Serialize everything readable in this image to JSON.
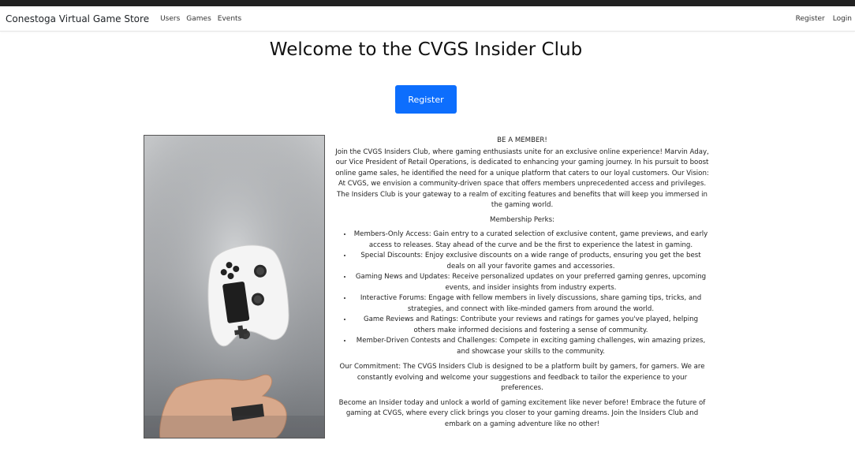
{
  "nav": {
    "brand": "Conestoga Virtual Game Store",
    "links": [
      "Users",
      "Games",
      "Events"
    ],
    "right_links": [
      "Register",
      "Login"
    ]
  },
  "main": {
    "title": "Welcome to the CVGS Insider Club",
    "register_button": "Register",
    "heading": "BE A MEMBER!",
    "intro": "Join the CVGS Insiders Club, where gaming enthusiasts unite for an exclusive online experience! Marvin Aday, our Vice President of Retail Operations, is dedicated to enhancing your gaming journey. In his pursuit to boost online game sales, he identified the need for a unique platform that caters to our loyal customers. Our Vision: At CVGS, we envision a community-driven space that offers members unprecedented access and privileges. The Insiders Club is your gateway to a realm of exciting features and benefits that will keep you immersed in the gaming world.",
    "perks_title": "Membership Perks:",
    "perks": [
      "Members-Only Access: Gain entry to a curated selection of exclusive content, game previews, and early access to releases. Stay ahead of the curve and be the first to experience the latest in gaming.",
      "Special Discounts: Enjoy exclusive discounts on a wide range of products, ensuring you get the best deals on all your favorite games and accessories.",
      "Gaming News and Updates: Receive personalized updates on your preferred gaming genres, upcoming events, and insider insights from industry experts.",
      "Interactive Forums: Engage with fellow members in lively discussions, share gaming tips, tricks, and strategies, and connect with like-minded gamers from around the world.",
      "Game Reviews and Ratings: Contribute your reviews and ratings for games you've played, helping others make informed decisions and fostering a sense of community.",
      "Member-Driven Contests and Challenges: Compete in exciting gaming challenges, win amazing prizes, and showcase your skills to the community."
    ],
    "commitment": "Our Commitment: The CVGS Insiders Club is designed to be a platform built by gamers, for gamers. We are constantly evolving and welcome your suggestions and feedback to tailor the experience to your preferences.",
    "closing": "Become an Insider today and unlock a world of gaming excitement like never before! Embrace the future of gaming at CVGS, where every click brings you closer to your gaming dreams. Join the Insiders Club and embark on a gaming adventure like no other!"
  },
  "colors": {
    "primary": "#0d6efd",
    "topbar": "#212121"
  }
}
